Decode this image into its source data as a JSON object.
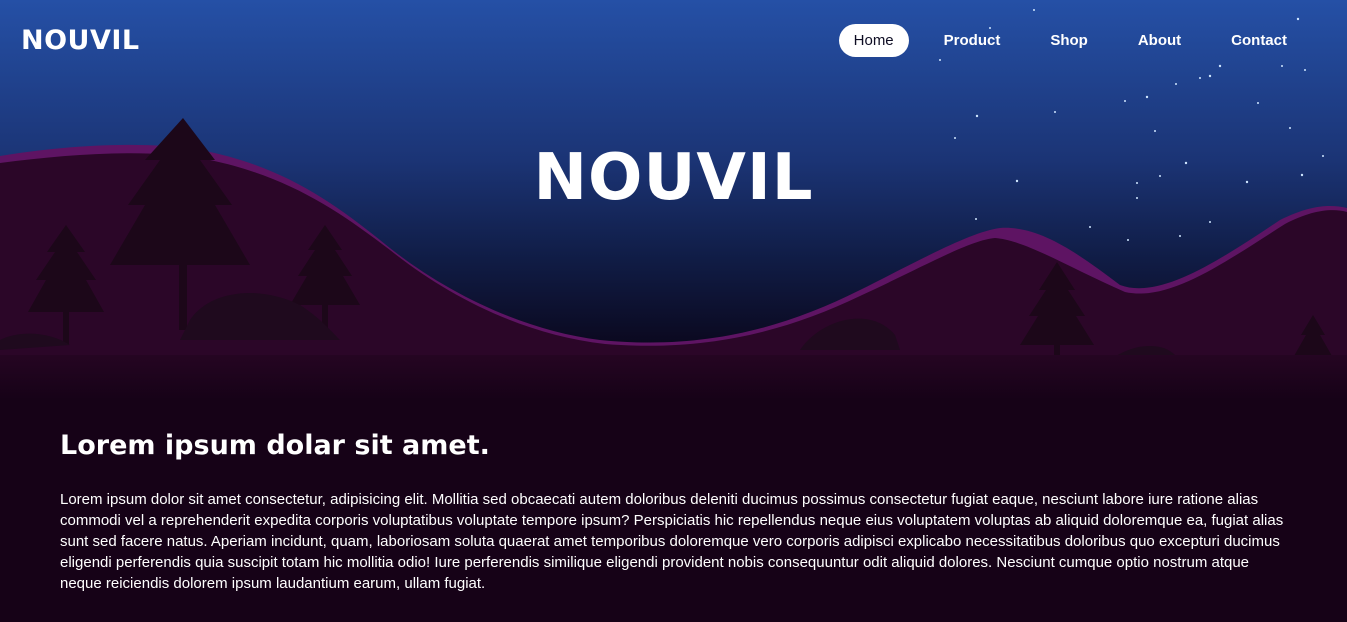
{
  "nav": {
    "brand": "NOUVIL",
    "links": [
      {
        "label": "Home",
        "active": true
      },
      {
        "label": "Product",
        "active": false
      },
      {
        "label": "Shop",
        "active": false
      },
      {
        "label": "About",
        "active": false
      },
      {
        "label": "Contact",
        "active": false
      }
    ]
  },
  "hero": {
    "title": "NOUVIL",
    "colors": {
      "sky_top": "#2550a6",
      "sky_bottom": "#0a0518",
      "hill": "#2b0628",
      "hill_rim": "#5e1463",
      "tree": "#1c0719",
      "ground": "#160217"
    }
  },
  "content": {
    "heading": "Lorem ipsum dolar sit amet.",
    "paragraph": "Lorem ipsum dolor sit amet consectetur, adipisicing elit. Mollitia sed obcaecati autem doloribus deleniti ducimus possimus consectetur fugiat eaque, nesciunt labore iure ratione alias commodi vel a reprehenderit expedita corporis voluptatibus voluptate tempore ipsum? Perspiciatis hic repellendus neque eius voluptatem voluptas ab aliquid doloremque ea, fugiat alias sunt sed facere natus. Aperiam incidunt, quam, laboriosam soluta quaerat amet temporibus doloremque vero corporis adipisci explicabo necessitatibus doloribus quo excepturi ducimus eligendi perferendis quia suscipit totam hic mollitia odio! Iure perferendis similique eligendi provident nobis consequuntur odit aliquid dolores. Nesciunt cumque optio nostrum atque neque reiciendis dolorem ipsum laudantium earum, ullam fugiat."
  }
}
